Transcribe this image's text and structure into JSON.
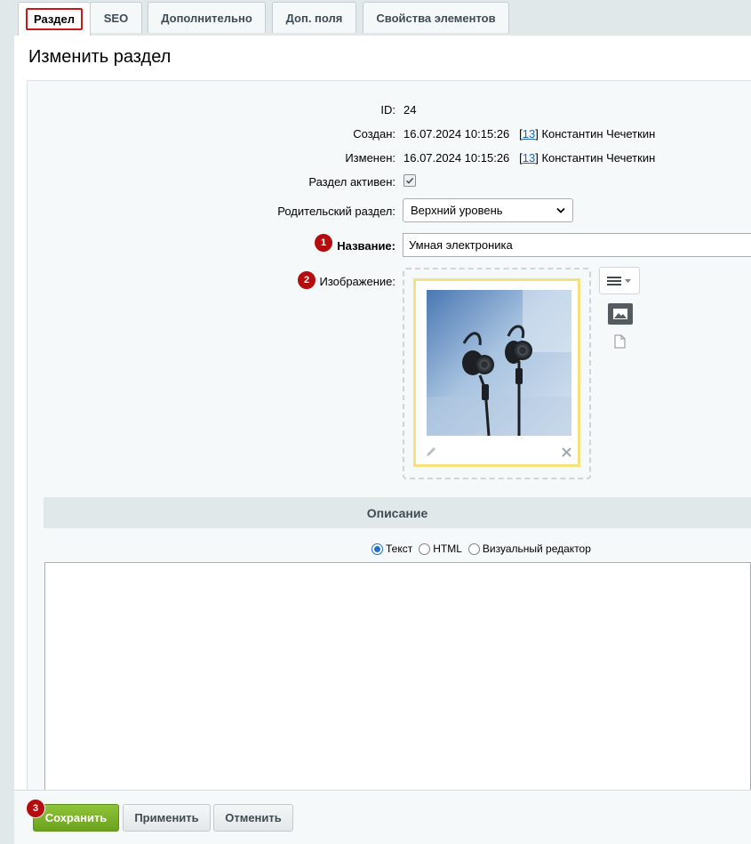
{
  "tabs": [
    {
      "label": "Раздел",
      "active": true
    },
    {
      "label": "SEO"
    },
    {
      "label": "Дополнительно"
    },
    {
      "label": "Доп. поля"
    },
    {
      "label": "Свойства элементов"
    }
  ],
  "page_title": "Изменить раздел",
  "fields": {
    "id": {
      "label": "ID:",
      "value": "24"
    },
    "created": {
      "label": "Создан:",
      "value": "16.07.2024 10:15:26",
      "user_id": "13",
      "user_name": "Константин Чечеткин"
    },
    "modified": {
      "label": "Изменен:",
      "value": "16.07.2024 10:15:26",
      "user_id": "13",
      "user_name": "Константин Чечеткин"
    },
    "active": {
      "label": "Раздел активен:",
      "checked": true
    },
    "parent": {
      "label": "Родительский раздел:",
      "value": "Верхний уровень"
    },
    "name": {
      "label": "Название:",
      "value": "Умная электроника",
      "badge": "1"
    },
    "image": {
      "label": "Изображение:",
      "badge": "2"
    }
  },
  "description": {
    "section_title": "Описание",
    "modes": [
      "Текст",
      "HTML",
      "Визуальный редактор"
    ],
    "selected_mode": "Текст"
  },
  "footer": {
    "save_label": "Сохранить",
    "apply_label": "Применить",
    "cancel_label": "Отменить",
    "badge": "3"
  },
  "colors": {
    "accent_green": "#6ba21d",
    "badge_red": "#b50d0d",
    "link": "#2067b0"
  }
}
